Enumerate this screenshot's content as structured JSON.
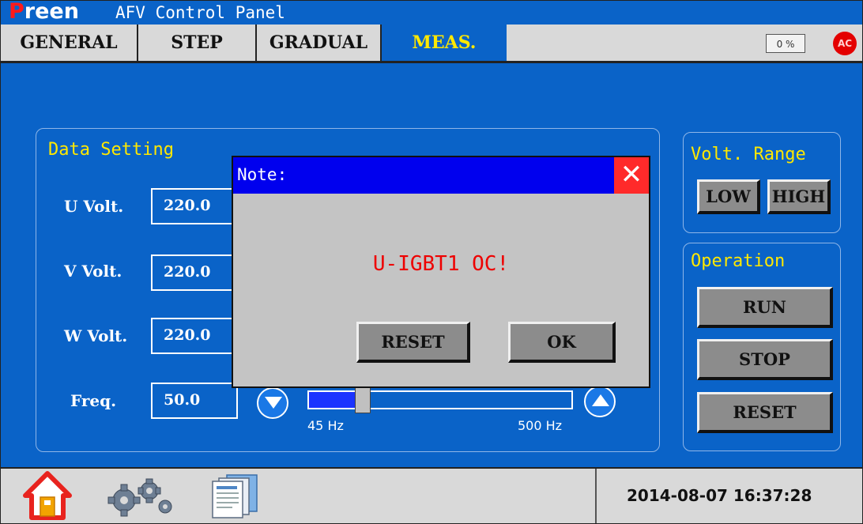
{
  "title": {
    "brand": "Preen",
    "brand_first": "P",
    "brand_rest": "reen",
    "app": "AFV Control Panel"
  },
  "tabs": [
    {
      "label": "GENERAL"
    },
    {
      "label": "STEP"
    },
    {
      "label": "GRADUAL"
    },
    {
      "label": "MEAS.",
      "active": true
    }
  ],
  "status": {
    "percent": "0 %",
    "ac": "AC"
  },
  "data_setting": {
    "title": "Data Setting",
    "fields": [
      {
        "label": "U Volt.",
        "value": "220.0"
      },
      {
        "label": "V Volt.",
        "value": "220.0"
      },
      {
        "label": "W Volt.",
        "value": "220.0"
      },
      {
        "label": "Freq.",
        "value": "50.0"
      }
    ],
    "slider": {
      "min_label": "45 Hz",
      "max_label": "500 Hz",
      "fill_fraction": 0.19
    }
  },
  "volt_range": {
    "title": "Volt. Range",
    "low": "LOW",
    "high": "HIGH"
  },
  "operation": {
    "title": "Operation",
    "run": "RUN",
    "stop": "STOP",
    "reset": "RESET"
  },
  "dialog": {
    "title": "Note:",
    "message": "U-IGBT1 OC!",
    "reset": "RESET",
    "ok": "OK",
    "close": "✕"
  },
  "footer": {
    "datetime": "2014-08-07 16:37:28"
  },
  "colors": {
    "background": "#0a63c8",
    "accent_yellow": "#ffe800",
    "alarm_red": "#ee0000",
    "dialog_header": "#0000ee"
  },
  "icons": [
    "home-icon",
    "settings-gears-icon",
    "documents-icon",
    "down-arrow-icon",
    "up-arrow-icon",
    "close-icon"
  ]
}
